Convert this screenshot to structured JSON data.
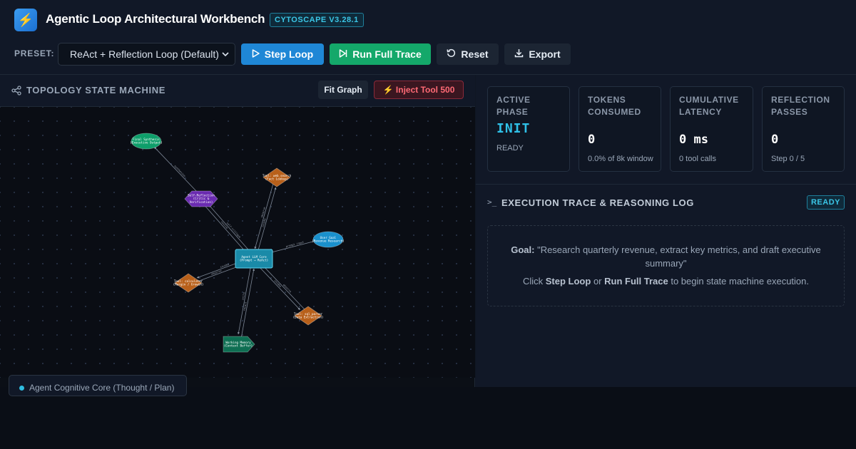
{
  "app": {
    "title": "Agentic Loop Architectural Workbench",
    "version": "CYTOSCAPE V3.28.1",
    "logo_icon": "lightning-icon"
  },
  "toolbar": {
    "preset_label": "PRESET:",
    "preset_value": "ReAct + Reflection Loop (Default)",
    "step_label": "Step Loop",
    "run_label": "Run Full Trace",
    "reset_label": "Reset",
    "export_label": "Export"
  },
  "topology": {
    "title": "TOPOLOGY STATE MACHINE",
    "fit_label": "Fit Graph",
    "inject_label": "⚡ Inject Tool 500",
    "nodes": [
      {
        "id": "final",
        "line1": "Final Synthesis",
        "line2": "(Executive Output)",
        "shape": "ellipse",
        "color": "#0e9e6a"
      },
      {
        "id": "reflect",
        "line1": "Self-Reflection",
        "line2": "(Critic &",
        "line3": "Verification)",
        "shape": "hexagon",
        "color": "#6a2bb0"
      },
      {
        "id": "web",
        "line1": "Tool: web_search",
        "line2": "(Fact Lookup)",
        "shape": "diamond",
        "color": "#b8601a"
      },
      {
        "id": "goal",
        "line1": "User Goal",
        "line2": "(Revenue Research)",
        "shape": "ellipse",
        "color": "#1a90cc"
      },
      {
        "id": "core",
        "line1": "Agent LLM Core",
        "line2": "(Prompt → ReAct)",
        "shape": "rect",
        "color": "#1a8aa8"
      },
      {
        "id": "calc",
        "line1": "Tool: calculator",
        "line2": "(Margin / Growth)",
        "shape": "diamond",
        "color": "#b8601a"
      },
      {
        "id": "sql",
        "line1": "Tool: sql_parser",
        "line2": "(Data Extraction)",
        "shape": "diamond",
        "color": "#b8601a"
      },
      {
        "id": "memory",
        "line1": "Working Memory",
        "line2": "(Context Buffer)",
        "shape": "tag",
        "color": "#0e6e52"
      }
    ],
    "edges": [
      {
        "from": "reflect",
        "to": "final",
        "label": "synthesize"
      },
      {
        "from": "core",
        "to": "reflect",
        "label": "self-critique"
      },
      {
        "from": "reflect",
        "to": "core",
        "label": "revise"
      },
      {
        "from": "core",
        "to": "web",
        "label": "invoke"
      },
      {
        "from": "web",
        "to": "core",
        "label": "observe"
      },
      {
        "from": "goal",
        "to": "core",
        "label": "prompt input"
      },
      {
        "from": "calc",
        "to": "core",
        "label": "observe"
      },
      {
        "from": "core",
        "to": "calc",
        "label": "invoke"
      },
      {
        "from": "core",
        "to": "sql",
        "label": "invoke"
      },
      {
        "from": "sql",
        "to": "core",
        "label": "observe"
      },
      {
        "from": "core",
        "to": "memory",
        "label": "write"
      },
      {
        "from": "memory",
        "to": "core",
        "label": "recall"
      }
    ],
    "legend": "Agent Cognitive Core (Thought / Plan)"
  },
  "metrics": {
    "phase": {
      "label": "ACTIVE PHASE",
      "value": "INIT",
      "sub": "READY"
    },
    "tokens": {
      "label": "TOKENS CONSUMED",
      "value": "0",
      "sub": "0.0% of 8k window"
    },
    "latency": {
      "label": "CUMULATIVE LATENCY",
      "value": "0 ms",
      "sub": "0 tool calls"
    },
    "reflection": {
      "label": "REFLECTION PASSES",
      "value": "0",
      "sub": "Step 0 / 5"
    }
  },
  "trace": {
    "title": "EXECUTION TRACE & REASONING LOG",
    "status": "READY",
    "goal_label": "Goal:",
    "goal_text": "\"Research quarterly revenue, extract key metrics, and draft executive summary\"",
    "hint_prefix": "Click",
    "hint_step": "Step Loop",
    "hint_or": "or",
    "hint_run": "Run Full Trace",
    "hint_suffix": "to begin state machine execution."
  }
}
